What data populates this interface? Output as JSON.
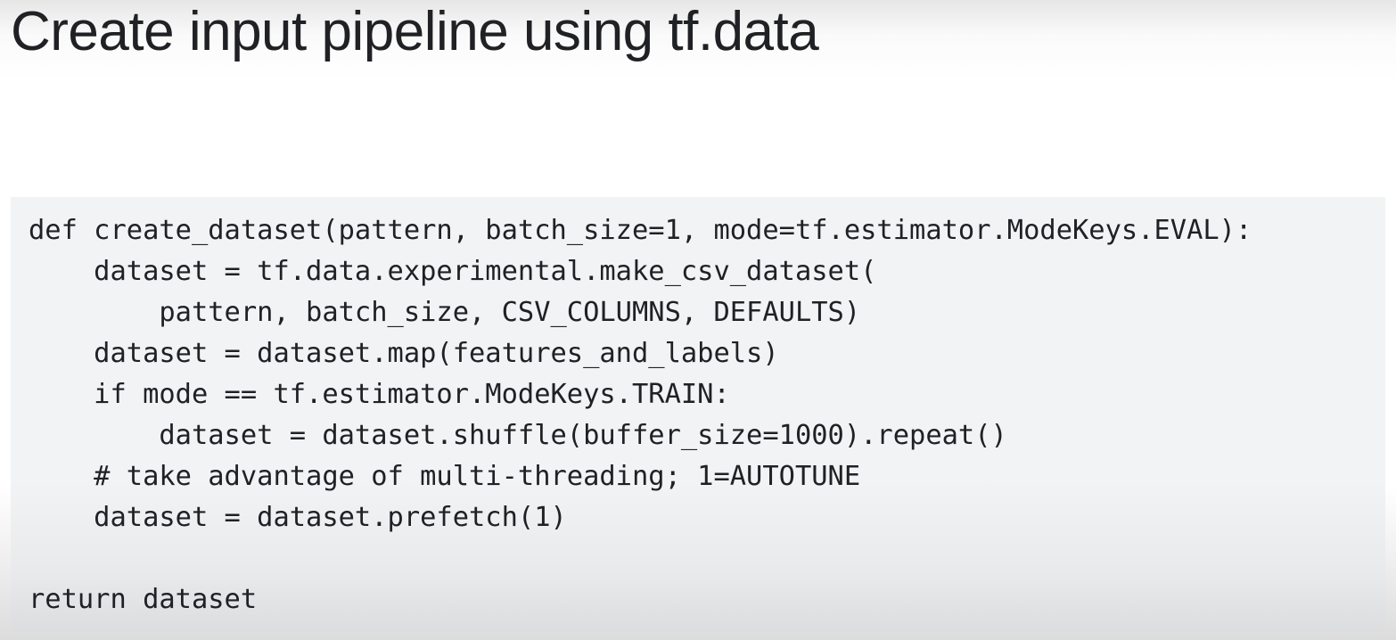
{
  "slide": {
    "title": "Create input pipeline using tf.data"
  },
  "code": {
    "line_1": "def create_dataset(pattern, batch_size=1, mode=tf.estimator.ModeKeys.EVAL):",
    "line_2": "    dataset = tf.data.experimental.make_csv_dataset(",
    "line_3": "        pattern, batch_size, CSV_COLUMNS, DEFAULTS)",
    "line_4": "    dataset = dataset.map(features_and_labels)",
    "line_5": "    if mode == tf.estimator.ModeKeys.TRAIN:",
    "line_6": "        dataset = dataset.shuffle(buffer_size=1000).repeat()",
    "line_7": "    # take advantage of multi-threading; 1=AUTOTUNE",
    "line_8": "    dataset = dataset.prefetch(1)",
    "line_9": "return dataset"
  },
  "colors": {
    "title_text": "#202124",
    "code_text": "#202124",
    "code_background": "#f1f3f4"
  }
}
